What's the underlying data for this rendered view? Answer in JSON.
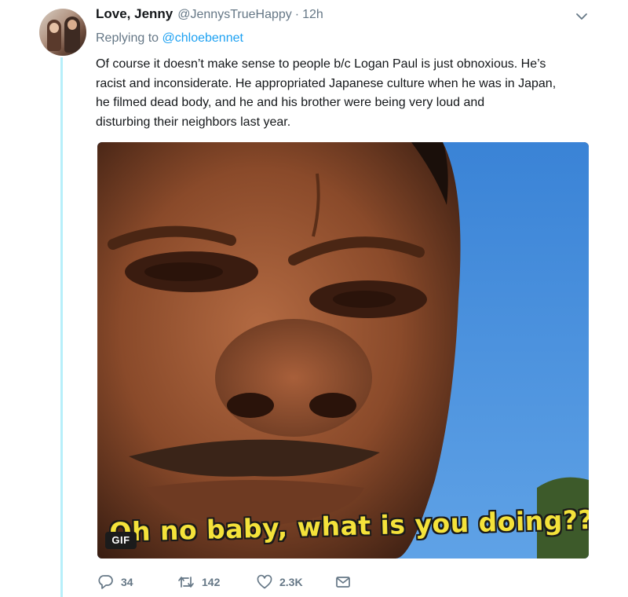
{
  "tweet": {
    "author_name": "Love, Jenny",
    "handle": "@JennysTrueHappy",
    "separator": "·",
    "time": "12h",
    "replying_prefix": "Replying to",
    "replying_to": "@chloebennet",
    "text_lines": [
      "Of course it doesn’t make sense to people b/c Logan Paul is just obnoxious. He’s",
      "racist and inconsiderate. He appropriated Japanese culture when he was in Japan,",
      "he filmed dead body, and he and his brother were being very loud and",
      "disturbing their neighbors last year."
    ],
    "media": {
      "badge": "GIF",
      "caption": "Oh no baby, what is you doing???"
    },
    "actions": {
      "replies": "34",
      "retweets": "142",
      "likes": "2.3K"
    }
  },
  "icons": {
    "caret": "chevron-down-icon",
    "reply": "reply-icon",
    "retweet": "retweet-icon",
    "like": "heart-icon",
    "dm": "envelope-icon"
  },
  "colors": {
    "link": "#1da1f2",
    "secondary_text": "#657786",
    "thread_line": "#b7effa",
    "caption": "#f4e23a"
  }
}
